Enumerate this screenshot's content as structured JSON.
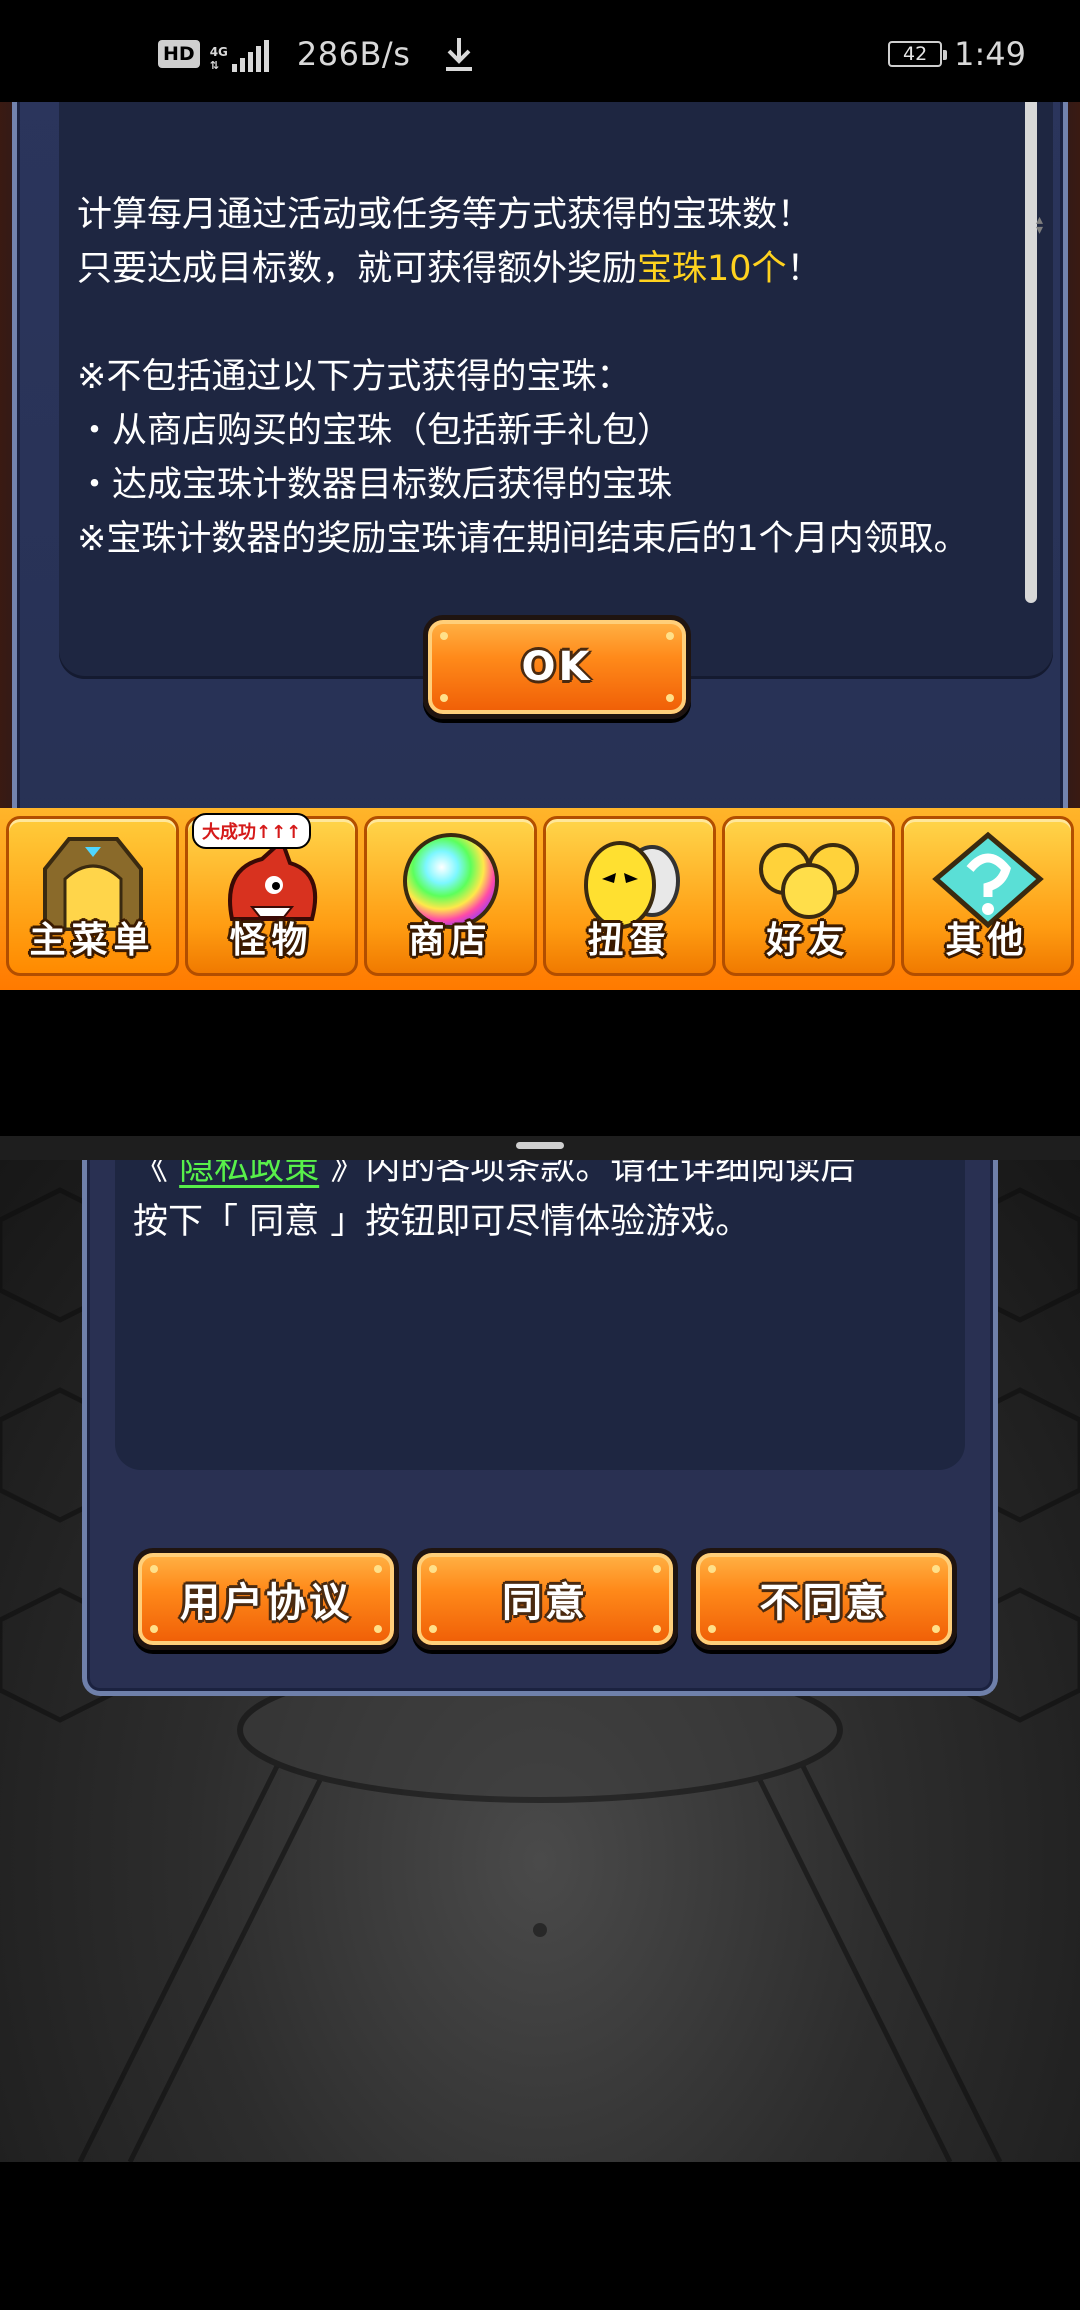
{
  "status_bar": {
    "hd_badge": "HD",
    "network_type": "4G",
    "net_speed": "286B/s",
    "battery_level": "42",
    "time": "1:49"
  },
  "top_app": {
    "info_lines": [
      "计算每月通过活动或任务等方式获得的宝珠数！",
      "只要达成目标数，就可获得额外奖励",
      "宝珠10个",
      "！",
      "※不包括通过以下方式获得的宝珠：",
      "・从商店购买的宝珠（包括新手礼包）",
      "・达成宝珠计数器目标数后获得的宝珠",
      "※宝珠计数器的奖励宝珠请在期间结束后的1个月内领取。"
    ],
    "ok_button": "OK",
    "nav": [
      {
        "label": "主菜单",
        "icon": "gate-icon"
      },
      {
        "label": "怪物",
        "icon": "dragon-monster-icon",
        "badge": "大成功↑↑↑"
      },
      {
        "label": "商店",
        "icon": "rainbow-orb-icon"
      },
      {
        "label": "扭蛋",
        "icon": "egg-icon"
      },
      {
        "label": "好友",
        "icon": "balloon-friends-icon"
      },
      {
        "label": "其他",
        "icon": "question-diamond-icon"
      }
    ],
    "accent_colors": {
      "highlight": "#ffd21f",
      "button": "#ff8a1a",
      "panel": "#1e2641"
    }
  },
  "bottom_app": {
    "line1_open": "《",
    "privacy_link": "隐私政策",
    "line1_rest": "》内的各项条款。请在详细阅读后",
    "line2": "按下「 同意 」按钮即可尽情体验游戏。",
    "buttons": {
      "user_agreement": "用户协议",
      "agree": "同意",
      "disagree": "不同意"
    },
    "link_color": "#58f04a"
  }
}
